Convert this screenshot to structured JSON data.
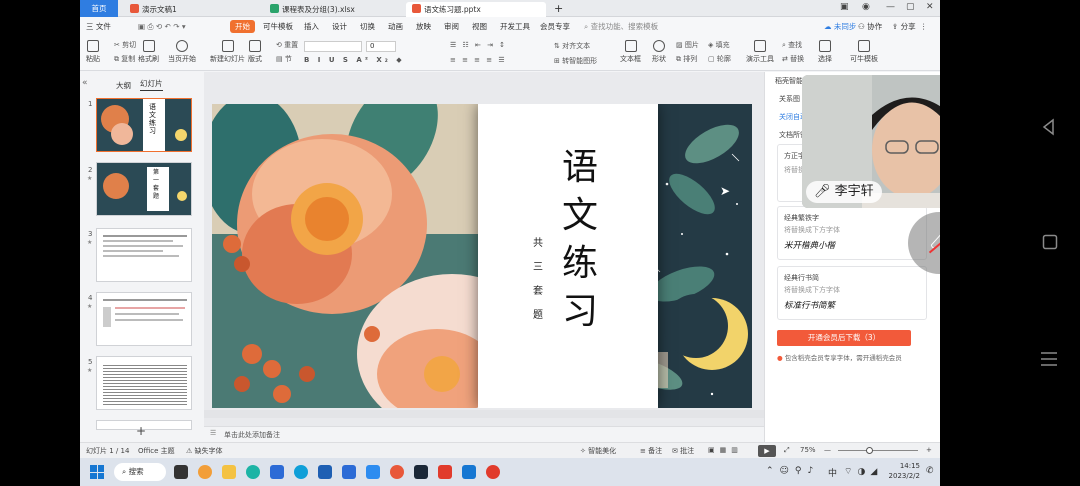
{
  "tabs": {
    "home": "首页",
    "tab1": "演示文稿1",
    "tab2": "课程表及分组(3).xlsx",
    "tab3": "语文练习题.pptx",
    "add": "+"
  },
  "header_right": {
    "not_synced": "未同步",
    "collab": "协作",
    "share": "分享"
  },
  "menu": {
    "file": "三 文件",
    "items": [
      "开始",
      "可牛模板",
      "插入",
      "设计",
      "切换",
      "动画",
      "放映",
      "审阅",
      "视图",
      "开发工具",
      "会员专享"
    ],
    "search_placeholder": "查找功能、搜索模板"
  },
  "ribbon": {
    "paste": "粘贴",
    "cut": "剪切",
    "copy": "复制",
    "format_painter": "格式刷",
    "play_from_current": "当页开始",
    "new_slide": "新建幻灯片",
    "layout": "版式",
    "section": "节",
    "reset": "重置",
    "text_box": "文本框",
    "shape": "形状",
    "arrange": "排列",
    "outline": "轮廓",
    "picture": "图片",
    "fill": "填充",
    "presentation_tools": "演示工具",
    "find": "查找",
    "replace": "替换",
    "select": "选择",
    "keniu_template": "可牛模板",
    "align_text": "对齐文本",
    "smart_art": "转智能图形",
    "font_size": "0"
  },
  "left_panel": {
    "tab_outline": "大纲",
    "tab_slides": "幻灯片",
    "thumbs": [
      {
        "num": "1",
        "title": "语文练习"
      },
      {
        "num": "2",
        "title": "第一套题"
      },
      {
        "num": "3",
        "title": ""
      },
      {
        "num": "4",
        "title": ""
      },
      {
        "num": "5",
        "title": ""
      }
    ],
    "add": "+"
  },
  "slide": {
    "title": "语文练习",
    "subtitle": "共三套题",
    "notes_placeholder": "单击此处添加备注"
  },
  "right_panel": {
    "header": "稻壳智能",
    "row1": "关系图",
    "row2": "关闭自动",
    "row3": "文档所需",
    "font1_name": "方正字",
    "font1_hint": "将替换",
    "font2_name": "经典繁铁字",
    "font2_hint": "将替换成下方字体",
    "font2_sample": "米开楷典小楷",
    "font3_name": "经典行书简",
    "font3_hint": "将替换成下方字体",
    "font3_sample": "标准行书简繁",
    "download_button": "开通会员后下载（3）",
    "notice": "包含稻壳会员专享字体，需开通稻壳会员"
  },
  "video": {
    "name": "李宇轩"
  },
  "status": {
    "slide_counter": "幻灯片 1 / 14",
    "theme": "Office 主题",
    "missing_font": "缺失字体",
    "smart_beautify": "智能美化",
    "notes": "备注",
    "comments": "批注",
    "zoom": "75%",
    "minus": "—",
    "plus": "+"
  },
  "taskbar": {
    "search": "搜索",
    "ime": "中",
    "time": "14:15",
    "date": "2023/2/2"
  },
  "colors": {
    "accent_orange": "#f0702f",
    "home_blue": "#2f7de1",
    "download_red": "#f25a3a"
  }
}
